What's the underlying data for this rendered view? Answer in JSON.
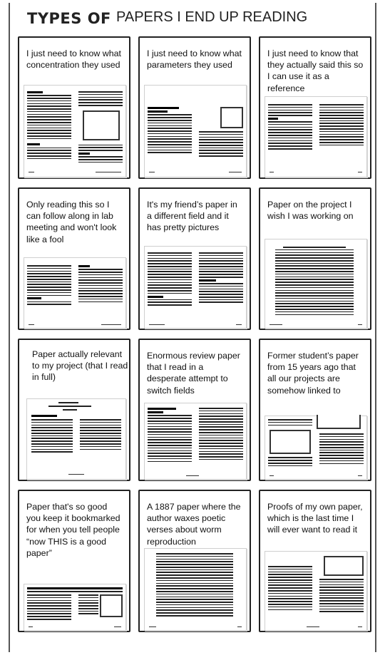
{
  "title": {
    "prefix": "TYPES OF",
    "main": "PAPERS I END UP READING"
  },
  "panels": [
    {
      "caption": "I just need to know what concentration they used"
    },
    {
      "caption": "I just need to know what parameters they used"
    },
    {
      "caption": "I just need to know that they actually said this so I can use it as a reference"
    },
    {
      "caption": "Only reading this so I can follow along in lab meeting and won't look like a fool"
    },
    {
      "caption": "It's my friend’s paper in a different field and it has pretty pictures"
    },
    {
      "caption": "Paper on the project I wish I was working on"
    },
    {
      "caption": "Paper actually relevant to my project (that I read in full)"
    },
    {
      "caption": "Enormous review paper that I read in a desperate attempt to switch fields"
    },
    {
      "caption": "Former student’s paper from 15 years ago that all our projects are somehow linked to"
    },
    {
      "caption": "Paper that's so good you keep it bookmarked for when you tell people “now THIS is a good paper”"
    },
    {
      "caption": "A 1887 paper where the author waxes poetic verses about worm reproduction"
    },
    {
      "caption": "Proofs of my own paper, which is the last time I will ever want to read it"
    }
  ]
}
